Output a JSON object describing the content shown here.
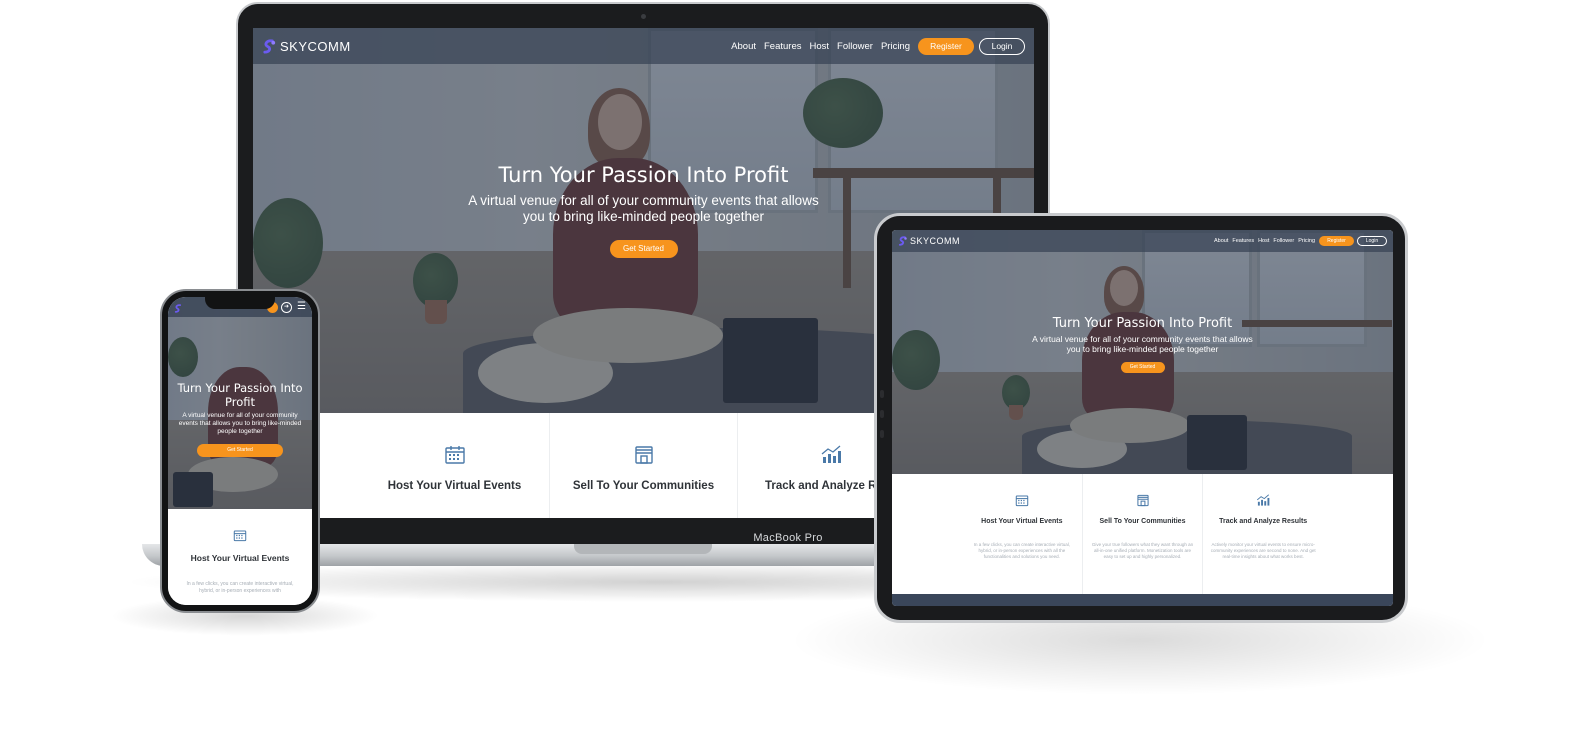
{
  "brand": {
    "name": "SKYCOMM",
    "accent": "#f7941d",
    "overlay": "#374254"
  },
  "nav": {
    "links": [
      "About",
      "Features",
      "Host",
      "Follower",
      "Pricing"
    ],
    "register": "Register",
    "login": "Login"
  },
  "hero": {
    "title": "Turn Your Passion Into Profit",
    "subtitle": "A virtual venue for all of your community events that allows you to bring like-minded people together",
    "cta": "Get Started"
  },
  "features": [
    {
      "title": "Host Your Virtual Events",
      "icon": "calendar-icon",
      "desc": "In a few clicks, you can create interactive virtual, hybrid, or in-person experiences with all the functionalities and solutions you need."
    },
    {
      "title": "Sell To Your Communities",
      "icon": "storefront-icon",
      "desc": "Give your true followers what they want through an all-in-one unified platform. Monetization tools are easy to set up and highly personalized."
    },
    {
      "title": "Track and Analyze Results",
      "icon": "bar-chart-icon",
      "desc": "Actively monitor your virtual events to ensure micro-community experiences are second to none. And get real-time insights about what works best."
    }
  ],
  "mac": {
    "title": "Track and Analyze Re",
    "label": "MacBook Pro"
  },
  "phone": {
    "title_line1": "Turn Your Passion Into",
    "title_line2": "Profit",
    "desc": "In a few clicks, you can create interactive virtual, hybrid, or in-person experiences with"
  }
}
